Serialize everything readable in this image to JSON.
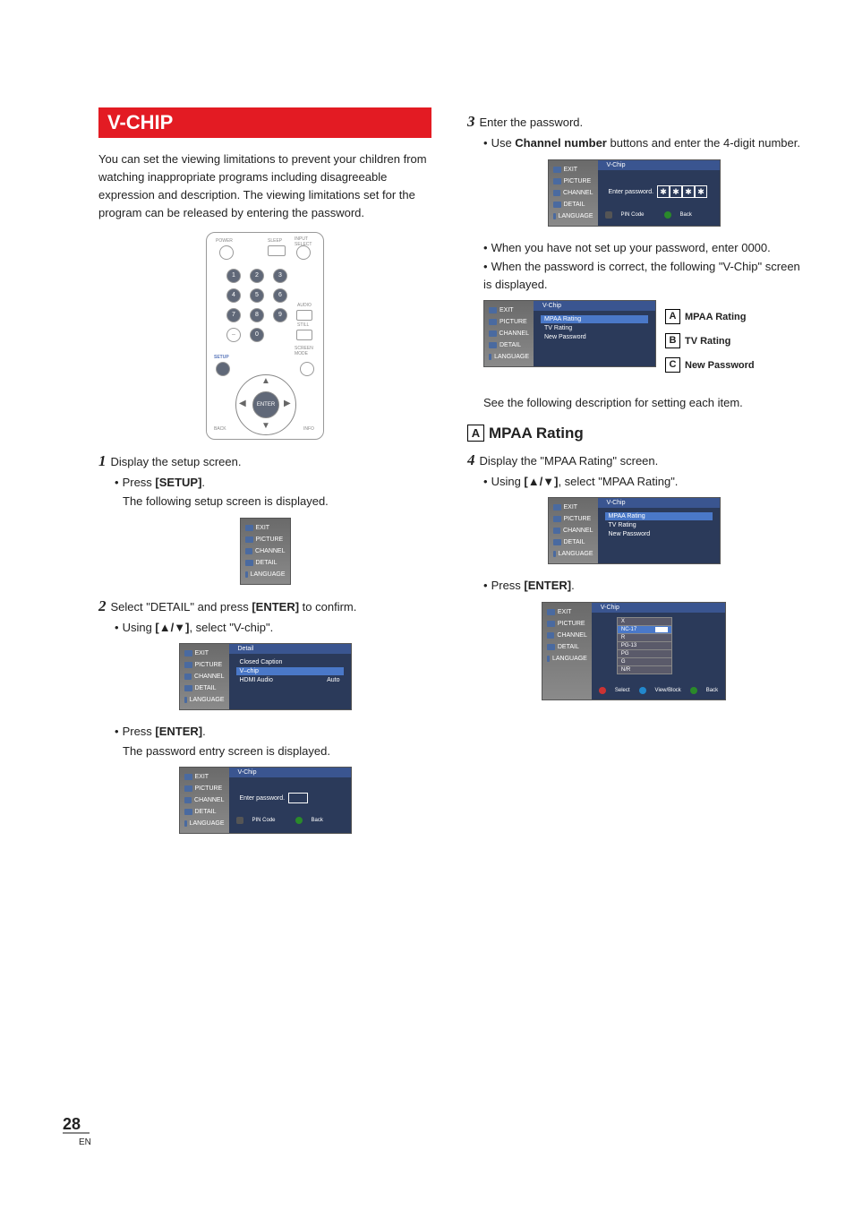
{
  "page_number": "28",
  "page_suffix": "EN",
  "section_title": "V-CHIP",
  "intro": "You can set the viewing limitations to prevent your children from watching inappropriate programs including disagreeable expression and description. The viewing limitations set for the program can be released by entering the password.",
  "remote": {
    "power": "POWER",
    "sleep": "SLEEP",
    "input": "INPUT SELECT",
    "audio": "AUDIO",
    "still": "STILL",
    "screen": "SCREEN MODE",
    "setup": "SETUP",
    "back": "BACK",
    "info": "INFO",
    "enter": "ENTER",
    "k1": "1",
    "k2": "2",
    "k3": "3",
    "k4": "4",
    "k5": "5",
    "k6": "6",
    "k7": "7",
    "k8": "8",
    "k9": "9",
    "k0": "0",
    "dash": "–"
  },
  "step1": {
    "text": "Display the setup screen.",
    "a": "Press ",
    "a_key": "[SETUP]",
    "a_tail": ".",
    "b": "The following setup screen is displayed."
  },
  "step2": {
    "text_a": "Select \"DETAIL\" and press ",
    "key": "[ENTER]",
    "text_b": " to confirm.",
    "sub_a": "Using ",
    "sub_key": "[▲/▼]",
    "sub_b": ", select \"V-chip\".",
    "c": "Press ",
    "c_key": "[ENTER]",
    "c_tail": ".",
    "d": "The password entry screen is displayed."
  },
  "step3": {
    "text": "Enter the password.",
    "a_pre": "Use ",
    "a_key": "Channel number",
    "a_post": " buttons and enter the 4-digit number.",
    "b": "When you have not set up your password, enter 0000.",
    "c": "When the password is correct, the following \"V-Chip\" screen is displayed.",
    "note": "See the following description for setting each item."
  },
  "callouts": {
    "A": "MPAA Rating",
    "B": "TV Rating",
    "C": "New Password"
  },
  "headingA": "MPAA Rating",
  "step4": {
    "text": "Display the \"MPAA Rating\" screen.",
    "a_pre": "Using ",
    "a_key": "[▲/▼]",
    "a_post": ", select \"MPAA Rating\".",
    "b_pre": "Press ",
    "b_key": "[ENTER]",
    "b_post": "."
  },
  "osd": {
    "side": {
      "exit": "EXIT",
      "picture": "PICTURE",
      "channel": "CHANNEL",
      "detail": "DETAIL",
      "language": "LANGUAGE"
    },
    "detail_title": "Detail",
    "detail_items": {
      "cc": "Closed Caption",
      "vchip": "V–chip",
      "hdmi": "HDMI Audio",
      "hdmi_val": "Auto"
    },
    "vchip_title": "V-Chip",
    "enter_password": "Enter password.",
    "pin": "PIN Code",
    "back": "Back",
    "mpaa": "MPAA Rating",
    "tvr": "TV Rating",
    "newpw": "New Password",
    "star": "✱",
    "select": "Select",
    "viewblock": "View/Block",
    "ratings": {
      "x": "X",
      "nc17": "NC-17",
      "r": "R",
      "pg13": "PG-13",
      "pg": "PG",
      "g": "G",
      "nr": "N/R"
    }
  }
}
